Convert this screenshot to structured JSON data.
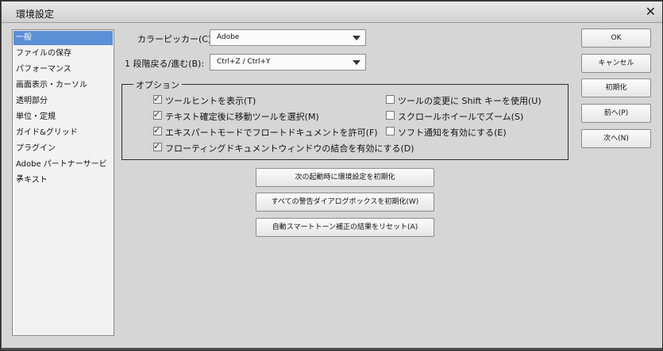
{
  "window": {
    "title": "環境設定",
    "close": "✕"
  },
  "sidebar": {
    "items": [
      {
        "label": "一般",
        "selected": true
      },
      {
        "label": "ファイルの保存"
      },
      {
        "label": "パフォーマンス"
      },
      {
        "label": "画面表示・カーソル"
      },
      {
        "label": "透明部分"
      },
      {
        "label": "単位・定規"
      },
      {
        "label": "ガイド&グリッド"
      },
      {
        "label": "プラグイン"
      },
      {
        "label": "Adobe パートナーサービス"
      },
      {
        "label": "テキスト"
      }
    ]
  },
  "fields": {
    "color_picker": {
      "label": "カラーピッカー(C):",
      "value": "Adobe"
    },
    "step_back_forward": {
      "label": "1 段階戻る/進む(B):",
      "value": "Ctrl+Z / Ctrl+Y"
    }
  },
  "options": {
    "legend": "オプション",
    "left": [
      {
        "label": "ツールヒントを表示(T)",
        "checked": true
      },
      {
        "label": "テキスト確定後に移動ツールを選択(M)",
        "checked": true
      },
      {
        "label": "エキスパートモードでフロートドキュメントを許可(F)",
        "checked": true
      },
      {
        "label": "フローティングドキュメントウィンドウの結合を有効にする(D)",
        "checked": true
      }
    ],
    "right": [
      {
        "label": "ツールの変更に Shift キーを使用(U)",
        "checked": false
      },
      {
        "label": "スクロールホイールでズーム(S)",
        "checked": false
      },
      {
        "label": "ソフト通知を有効にする(E)",
        "checked": false
      }
    ]
  },
  "reset_buttons": {
    "next_launch": "次の起動時に環境設定を初期化",
    "warning_dialogs": "すべての警告ダイアログボックスを初期化(W)",
    "smart_tone": "自動スマートトーン補正の結果をリセット(A)"
  },
  "side_buttons": {
    "ok": "OK",
    "cancel": "キャンセル",
    "reset": "初期化",
    "prev": "前へ(P)",
    "next": "次へ(N)"
  }
}
